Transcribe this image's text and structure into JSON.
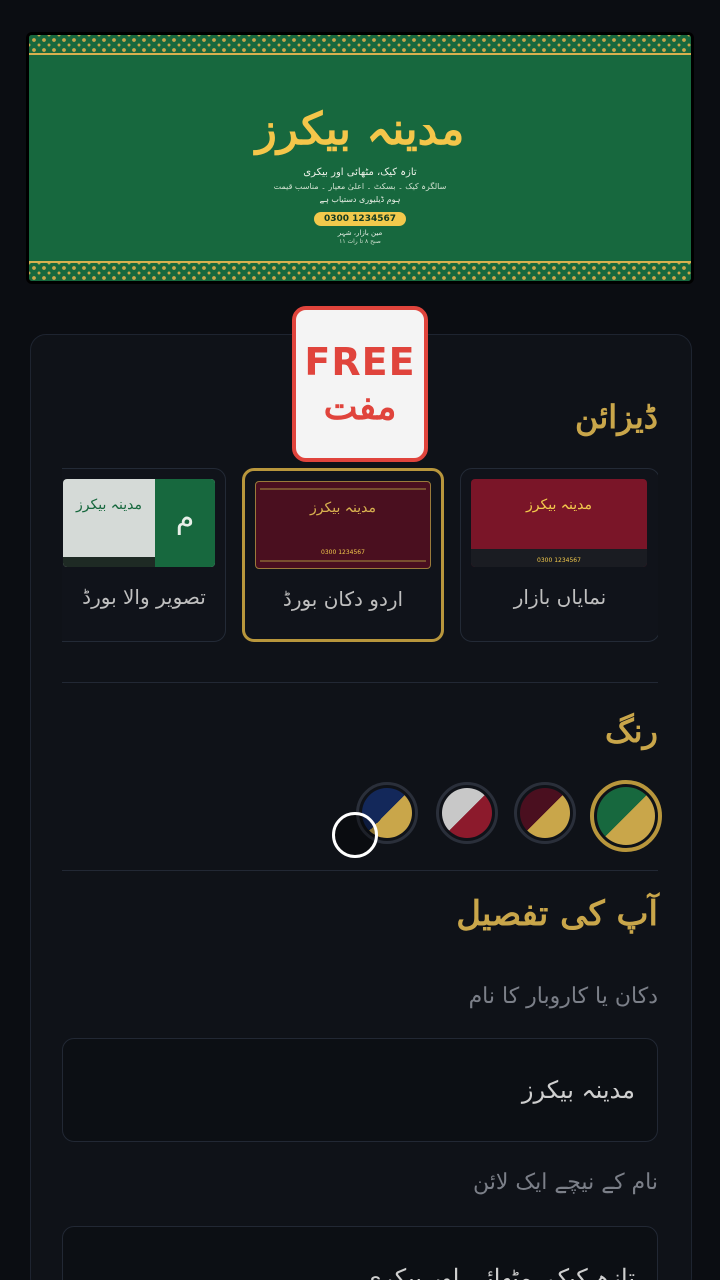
{
  "preview": {
    "title": "مدینہ بیکرز",
    "tagline": "تازہ کیک، مٹھائی اور بیکری",
    "line2": "سالگرہ کیک ۔ بسکٹ ۔ اعلیٰ معیار ۔ مناسب قیمت",
    "line3": "ہوم ڈیلیوری دستیاب ہے",
    "phone": "0300 1234567",
    "address": "مین بازار، شہر",
    "address2": "صبح ۸ تا رات ۱۱"
  },
  "badge": {
    "en": "FREE",
    "ur": "مفت"
  },
  "design_section": {
    "title": "ڈیزائن",
    "cards": [
      {
        "label": "نمایاں بازار",
        "thumb_title": "مدینہ بیکرز",
        "phone": "0300 1234567",
        "selected": false
      },
      {
        "label": "اردو دکان بورڈ",
        "thumb_title": "مدینہ بیکرز",
        "phone": "0300 1234567",
        "selected": true
      },
      {
        "label": "تصویر والا بورڈ",
        "thumb_title": "مدینہ بیکرز",
        "initial": "م",
        "selected": false
      }
    ]
  },
  "color_section": {
    "title": "رنگ",
    "swatches": [
      {
        "name": "green-gold",
        "primary": "#17683e",
        "secondary": "#c9a64a",
        "selected": true
      },
      {
        "name": "maroon-gold",
        "primary": "#4a0f1f",
        "secondary": "#c9a64a",
        "selected": false
      },
      {
        "name": "silver-red",
        "primary": "#c8c8c8",
        "secondary": "#8c1a2c",
        "selected": false
      },
      {
        "name": "navy-gold",
        "primary": "#13285a",
        "secondary": "#c9a64a",
        "selected": false
      }
    ]
  },
  "details_section": {
    "title": "آپ کی تفصیل",
    "business_name_label": "دکان یا کاروبار کا نام",
    "business_name_value": "مدینہ بیکرز",
    "tagline_label": "نام کے نیچے ایک لائن",
    "tagline_value": "تازہ کیک، مٹھائی اور بیکری"
  },
  "colors": {
    "accent": "#c9a64a",
    "badge_red": "#e0443c",
    "background": "#0b0d12"
  }
}
